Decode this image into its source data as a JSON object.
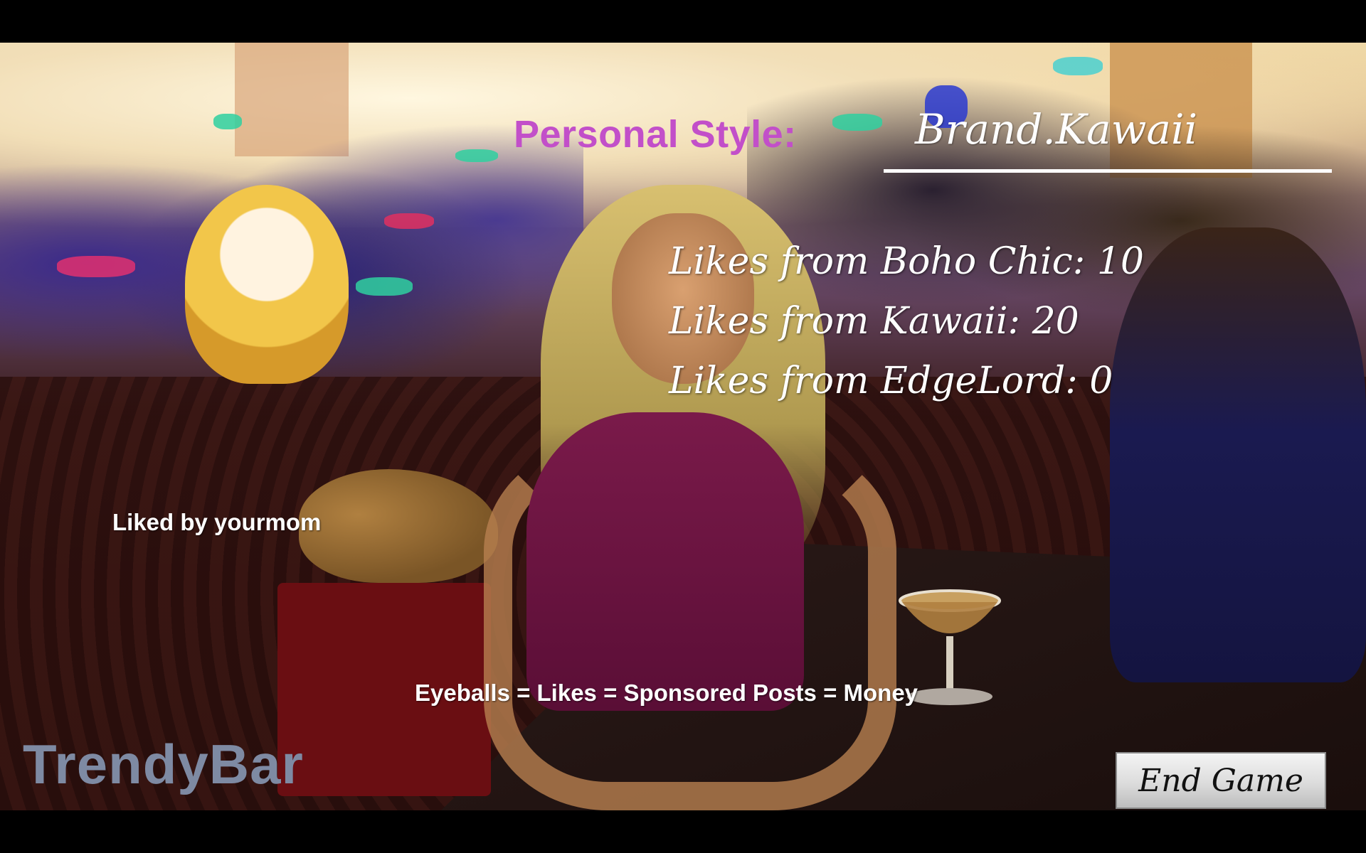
{
  "hud": {
    "personal_style_label": "Personal Style:",
    "personal_style_value": "Brand.Kawaii",
    "likes": [
      "Likes from Boho Chic: 10",
      "Likes from Kawaii: 20",
      "Likes from EdgeLord: 0"
    ],
    "liked_by": "Liked by yourmom",
    "tagline": "Eyeballs = Likes = Sponsored Posts = Money",
    "location": "TrendyBar"
  },
  "controls": {
    "end_game_label": "End Game"
  },
  "colors": {
    "personal_style_label": "#c24fc9",
    "location_text": "#7e8aa3"
  }
}
